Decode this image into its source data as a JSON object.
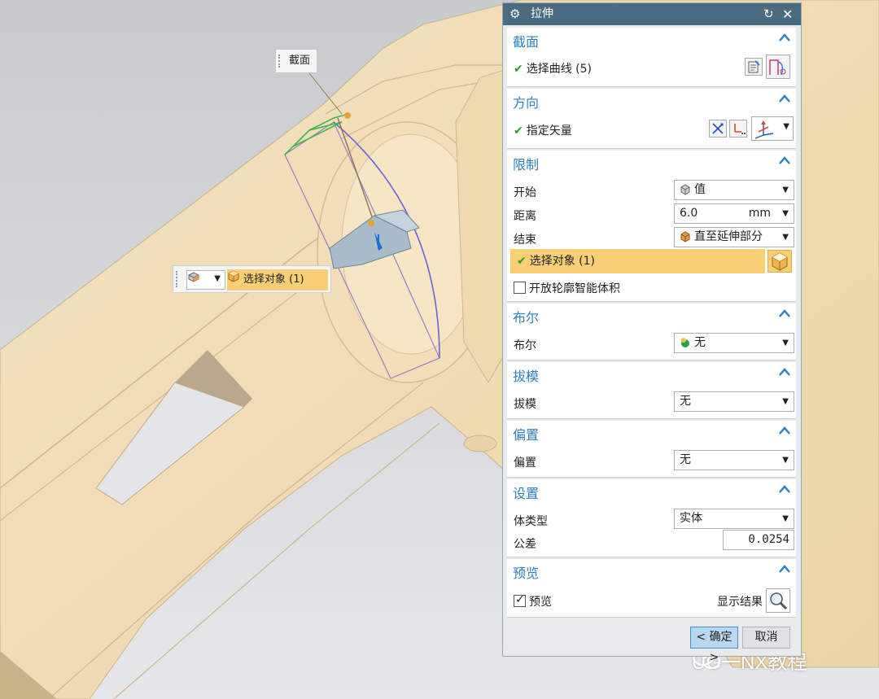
{
  "viewport": {
    "callout_label": "截面",
    "mini_toolbar": {
      "select_label": "选择对象 (1)"
    },
    "watermark": "UG一NX教程"
  },
  "dialog": {
    "title": "拉伸",
    "sections": {
      "section": {
        "header": "截面",
        "select_curve": "选择曲线 (5)"
      },
      "direction": {
        "header": "方向",
        "specify_vector": "指定矢量"
      },
      "limits": {
        "header": "限制",
        "start_label": "开始",
        "start_value": "值",
        "distance_label": "距离",
        "distance_value": "6.0",
        "distance_unit": "mm",
        "end_label": "结束",
        "end_value": "直至延伸部分",
        "select_object": "选择对象 (1)",
        "open_profile_label": "开放轮廓智能体积"
      },
      "boolean": {
        "header": "布尔",
        "label": "布尔",
        "value": "无"
      },
      "draft": {
        "header": "拔模",
        "label": "拔模",
        "value": "无"
      },
      "offset": {
        "header": "偏置",
        "label": "偏置",
        "value": "无"
      },
      "settings": {
        "header": "设置",
        "body_type_label": "体类型",
        "body_type_value": "实体",
        "tolerance_label": "公差",
        "tolerance_value": "0.0254"
      },
      "preview": {
        "header": "预览",
        "preview_label": "预览",
        "show_result_label": "显示结果"
      }
    },
    "buttons": {
      "ok": "< 确定 >",
      "cancel": "取消"
    }
  },
  "colors": {
    "header_text": "#2f7fbf",
    "titlebar": "#4b6b80",
    "highlight": "#f9cf75",
    "model": "#f0dcb4",
    "background": "#cfd1d4"
  }
}
